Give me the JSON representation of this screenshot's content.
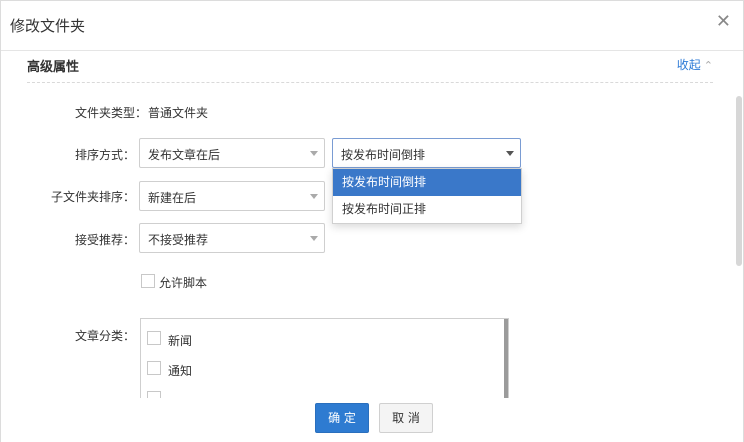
{
  "dialog": {
    "title": "修改文件夹",
    "close_icon": "close-icon"
  },
  "section": {
    "title": "高级属性",
    "collapse_label": "收起",
    "collapse_icon": "chevron-up-icon"
  },
  "fields": {
    "folder_type": {
      "label": "文件夹类型：",
      "value": "普通文件夹"
    },
    "sort": {
      "label": "排序方式：",
      "primary_value": "发布文章在后",
      "secondary_value": "按发布时间倒排",
      "secondary_options": [
        "按发布时间倒排",
        "按发布时间正排"
      ]
    },
    "subfolder_sort": {
      "label": "子文件夹排序：",
      "value": "新建在后"
    },
    "accept_recommend": {
      "label": "接受推荐：",
      "value": "不接受推荐"
    },
    "allow_script": {
      "label": "允许脚本"
    },
    "categories": {
      "label": "文章分类：",
      "items": [
        "新闻",
        "通知",
        "…"
      ]
    }
  },
  "footer": {
    "ok_label": "确 定",
    "cancel_label": "取 消"
  },
  "colors": {
    "accent": "#2e7bd1",
    "selected_option": "#3a78c9",
    "link": "#2c7ad6"
  }
}
